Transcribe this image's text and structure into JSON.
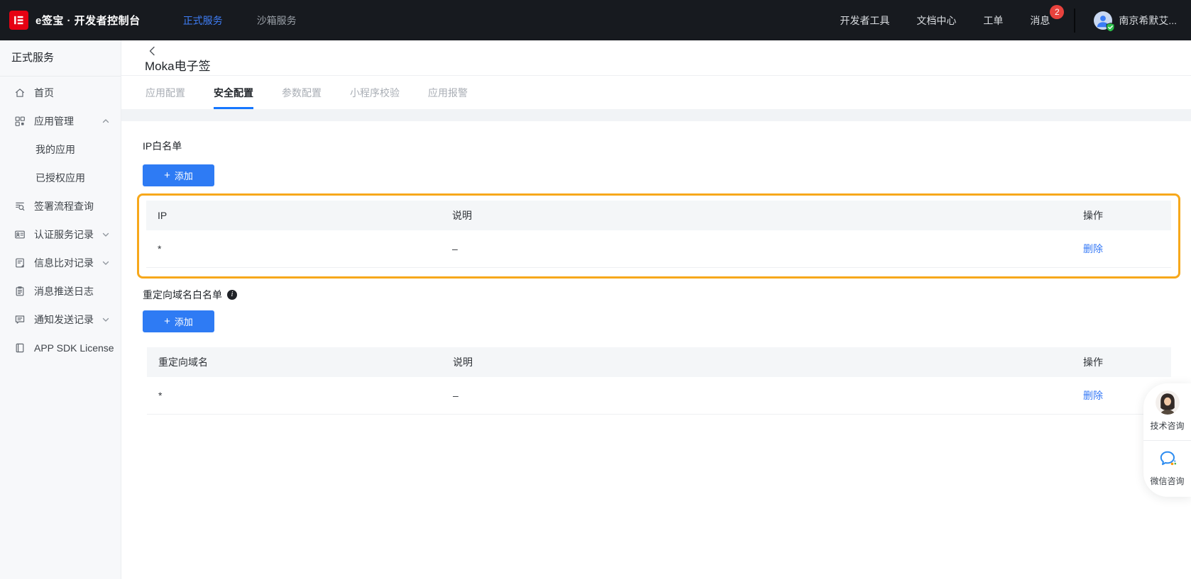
{
  "header": {
    "brand": "e签宝 · 开发者控制台",
    "nav": [
      "正式服务",
      "沙箱服务"
    ],
    "links": [
      "开发者工具",
      "文档中心",
      "工单",
      "消息"
    ],
    "message_badge": "2",
    "user_name": "南京希默艾..."
  },
  "sidebar": {
    "title": "正式服务",
    "items": [
      {
        "label": "首页",
        "icon": "home-icon"
      },
      {
        "label": "应用管理",
        "icon": "apps-icon",
        "expanded": true
      },
      {
        "label": "我的应用",
        "sub": true
      },
      {
        "label": "已授权应用",
        "sub": true
      },
      {
        "label": "签署流程查询",
        "icon": "flow-search-icon"
      },
      {
        "label": "认证服务记录",
        "icon": "id-card-icon",
        "collapsed": true
      },
      {
        "label": "信息比对记录",
        "icon": "compare-icon",
        "collapsed": true
      },
      {
        "label": "消息推送日志",
        "icon": "log-icon"
      },
      {
        "label": "通知发送记录",
        "icon": "notify-icon",
        "collapsed": true
      },
      {
        "label": "APP SDK License",
        "icon": "license-icon"
      }
    ]
  },
  "main": {
    "page_title": "Moka电子签",
    "tabs": [
      {
        "label": "应用配置"
      },
      {
        "label": "安全配置",
        "active": true
      },
      {
        "label": "参数配置"
      },
      {
        "label": "小程序校验"
      },
      {
        "label": "应用报警"
      }
    ]
  },
  "ip_section": {
    "title": "IP白名单",
    "add_label": "添加",
    "columns": [
      "IP",
      "说明",
      "操作"
    ],
    "row": {
      "ip": "*",
      "desc": "–",
      "action": "删除"
    }
  },
  "redirect_section": {
    "title": "重定向域名白名单",
    "add_label": "添加",
    "columns": [
      "重定向域名",
      "说明",
      "操作"
    ],
    "row": {
      "domain": "*",
      "desc": "–",
      "action": "删除"
    }
  },
  "floating": {
    "tech_label": "技术咨询",
    "wechat_label": "微信咨询"
  },
  "icons": {
    "plus": "+",
    "info": "i"
  },
  "colors": {
    "header_bg": "#171a1f",
    "brand_red": "#e60113",
    "accent_blue": "#1677ff",
    "button_blue": "#2e7bf4",
    "link_blue": "#3478f6",
    "badge_red": "#e8423d",
    "highlight_orange": "#f7a81b",
    "sidebar_bg": "#f7f8fa",
    "table_header_bg": "#f4f6f8"
  }
}
